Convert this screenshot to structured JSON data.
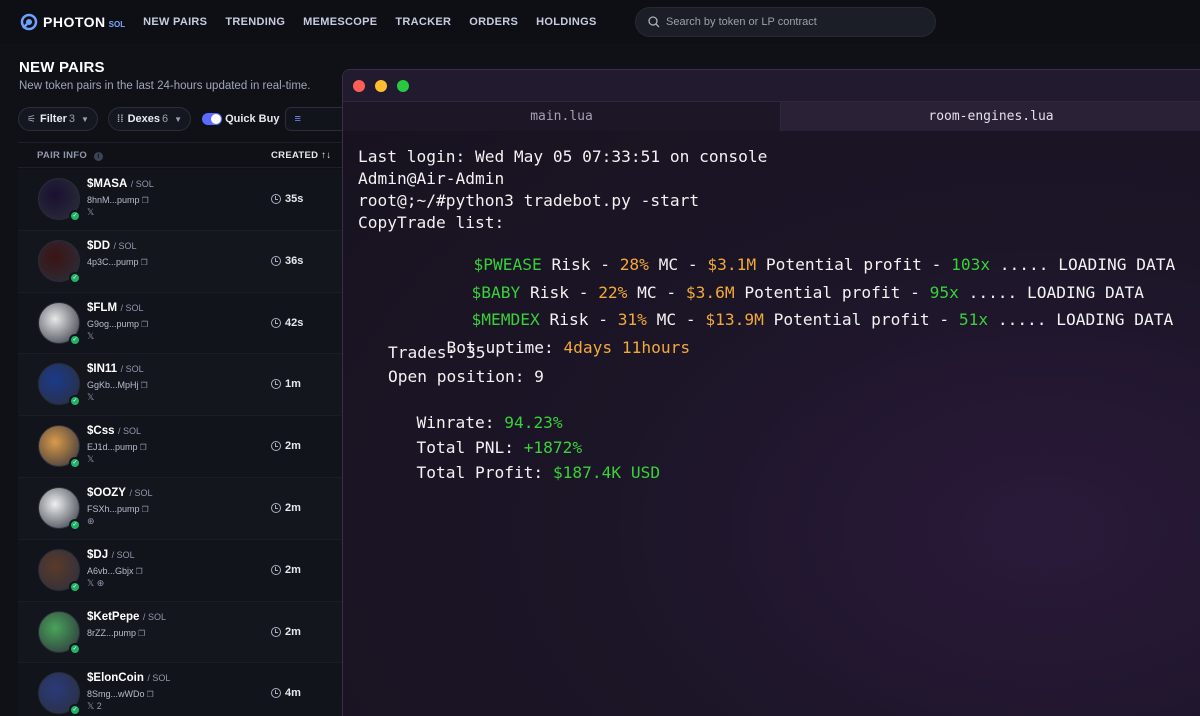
{
  "app": {
    "brand": "PHOTON",
    "brand_sub": "SOL"
  },
  "nav": [
    "NEW PAIRS",
    "TRENDING",
    "MEMESCOPE",
    "TRACKER",
    "ORDERS",
    "HOLDINGS"
  ],
  "search": {
    "placeholder": "Search by token or LP contract"
  },
  "page": {
    "title": "NEW PAIRS",
    "subtitle": "New token pairs in the last 24-hours updated in real-time."
  },
  "filters": {
    "filter_label": "Filter",
    "filter_count": "3",
    "dexes_label": "Dexes",
    "dexes_count": "6",
    "quick_buy_label": "Quick Buy",
    "quick_buy_enabled": true
  },
  "table": {
    "col_pair": "PAIR INFO",
    "col_created": "CREATED",
    "rows": [
      {
        "token": "$MASA",
        "pair": "SOL",
        "address": "8hnM...pump",
        "socials": "𝕏",
        "age": "35s",
        "avatar_color": "#1a1030"
      },
      {
        "token": "$DD",
        "pair": "SOL",
        "address": "4p3C...pump",
        "socials": "",
        "age": "36s",
        "avatar_color": "#3a1414"
      },
      {
        "token": "$FLM",
        "pair": "SOL",
        "address": "G9og...pump",
        "socials": "𝕏",
        "age": "42s",
        "avatar_color": "#e8e8e8"
      },
      {
        "token": "$IN11",
        "pair": "SOL",
        "address": "GgKb...MpHj",
        "socials": "𝕏",
        "age": "1m",
        "avatar_color": "#1b3a8a"
      },
      {
        "token": "$Css",
        "pair": "SOL",
        "address": "EJ1d...pump",
        "socials": "𝕏",
        "age": "2m",
        "avatar_color": "#d99a4a"
      },
      {
        "token": "$OOZY",
        "pair": "SOL",
        "address": "FSXh...pump",
        "socials": "⊕",
        "age": "2m",
        "avatar_color": "#eef0ee"
      },
      {
        "token": "$DJ",
        "pair": "SOL",
        "address": "A6vb...Gbjx",
        "socials": "𝕏 ⊕",
        "age": "2m",
        "avatar_color": "#5a3a2a"
      },
      {
        "token": "$KetPepe",
        "pair": "SOL",
        "address": "8rZZ...pump",
        "socials": "",
        "age": "2m",
        "avatar_color": "#4aa35a"
      },
      {
        "token": "$ElonCoin",
        "pair": "SOL",
        "address": "8Smg...wWDo",
        "socials": "𝕏 2",
        "age": "4m",
        "avatar_color": "#2a3a7a"
      }
    ]
  },
  "terminal": {
    "tabs": [
      "main.lua",
      "room-engines.lua"
    ],
    "active_tab": "room-engines.lua",
    "line_login": "Last login: Wed May 05 07:33:51 on console",
    "line_user": "Admin@Air-Admin",
    "line_cmd": "root@;~/#python3 tradebot.py -start",
    "line_list": "CopyTrade list:",
    "trades": [
      {
        "symbol": "$PWEASE",
        "risk": "28%",
        "mc": "$3.1M",
        "profit": "103x"
      },
      {
        "symbol": "$BABY",
        "risk": "22%",
        "mc": "$3.6M",
        "profit": "95x"
      },
      {
        "symbol": "$MEMDEX",
        "risk": "31%",
        "mc": "$13.9M",
        "profit": "51x"
      }
    ],
    "risk_label": " Risk - ",
    "mc_label": " MC - ",
    "profit_label": " Potential profit - ",
    "loading_label": " ..... LOADING DATA",
    "uptime_label": "Bot uptime: ",
    "uptime_value": "4days 11hours",
    "trades_label": "Trades: 35",
    "open_label": "Open position: 9",
    "winrate_label": "Winrate: ",
    "winrate_value": "94.23%",
    "pnl_label": "Total PNL: ",
    "pnl_value": "+1872%",
    "profit_total_label": "Total Profit: ",
    "profit_total_value": "$187.4K USD"
  },
  "colors": {
    "accent": "#5a6bff",
    "terminal_yellow": "#f2a93b",
    "terminal_green": "#38d13a",
    "traffic_red": "#ff5f57",
    "traffic_yellow": "#febc2e",
    "traffic_green": "#28c840"
  }
}
